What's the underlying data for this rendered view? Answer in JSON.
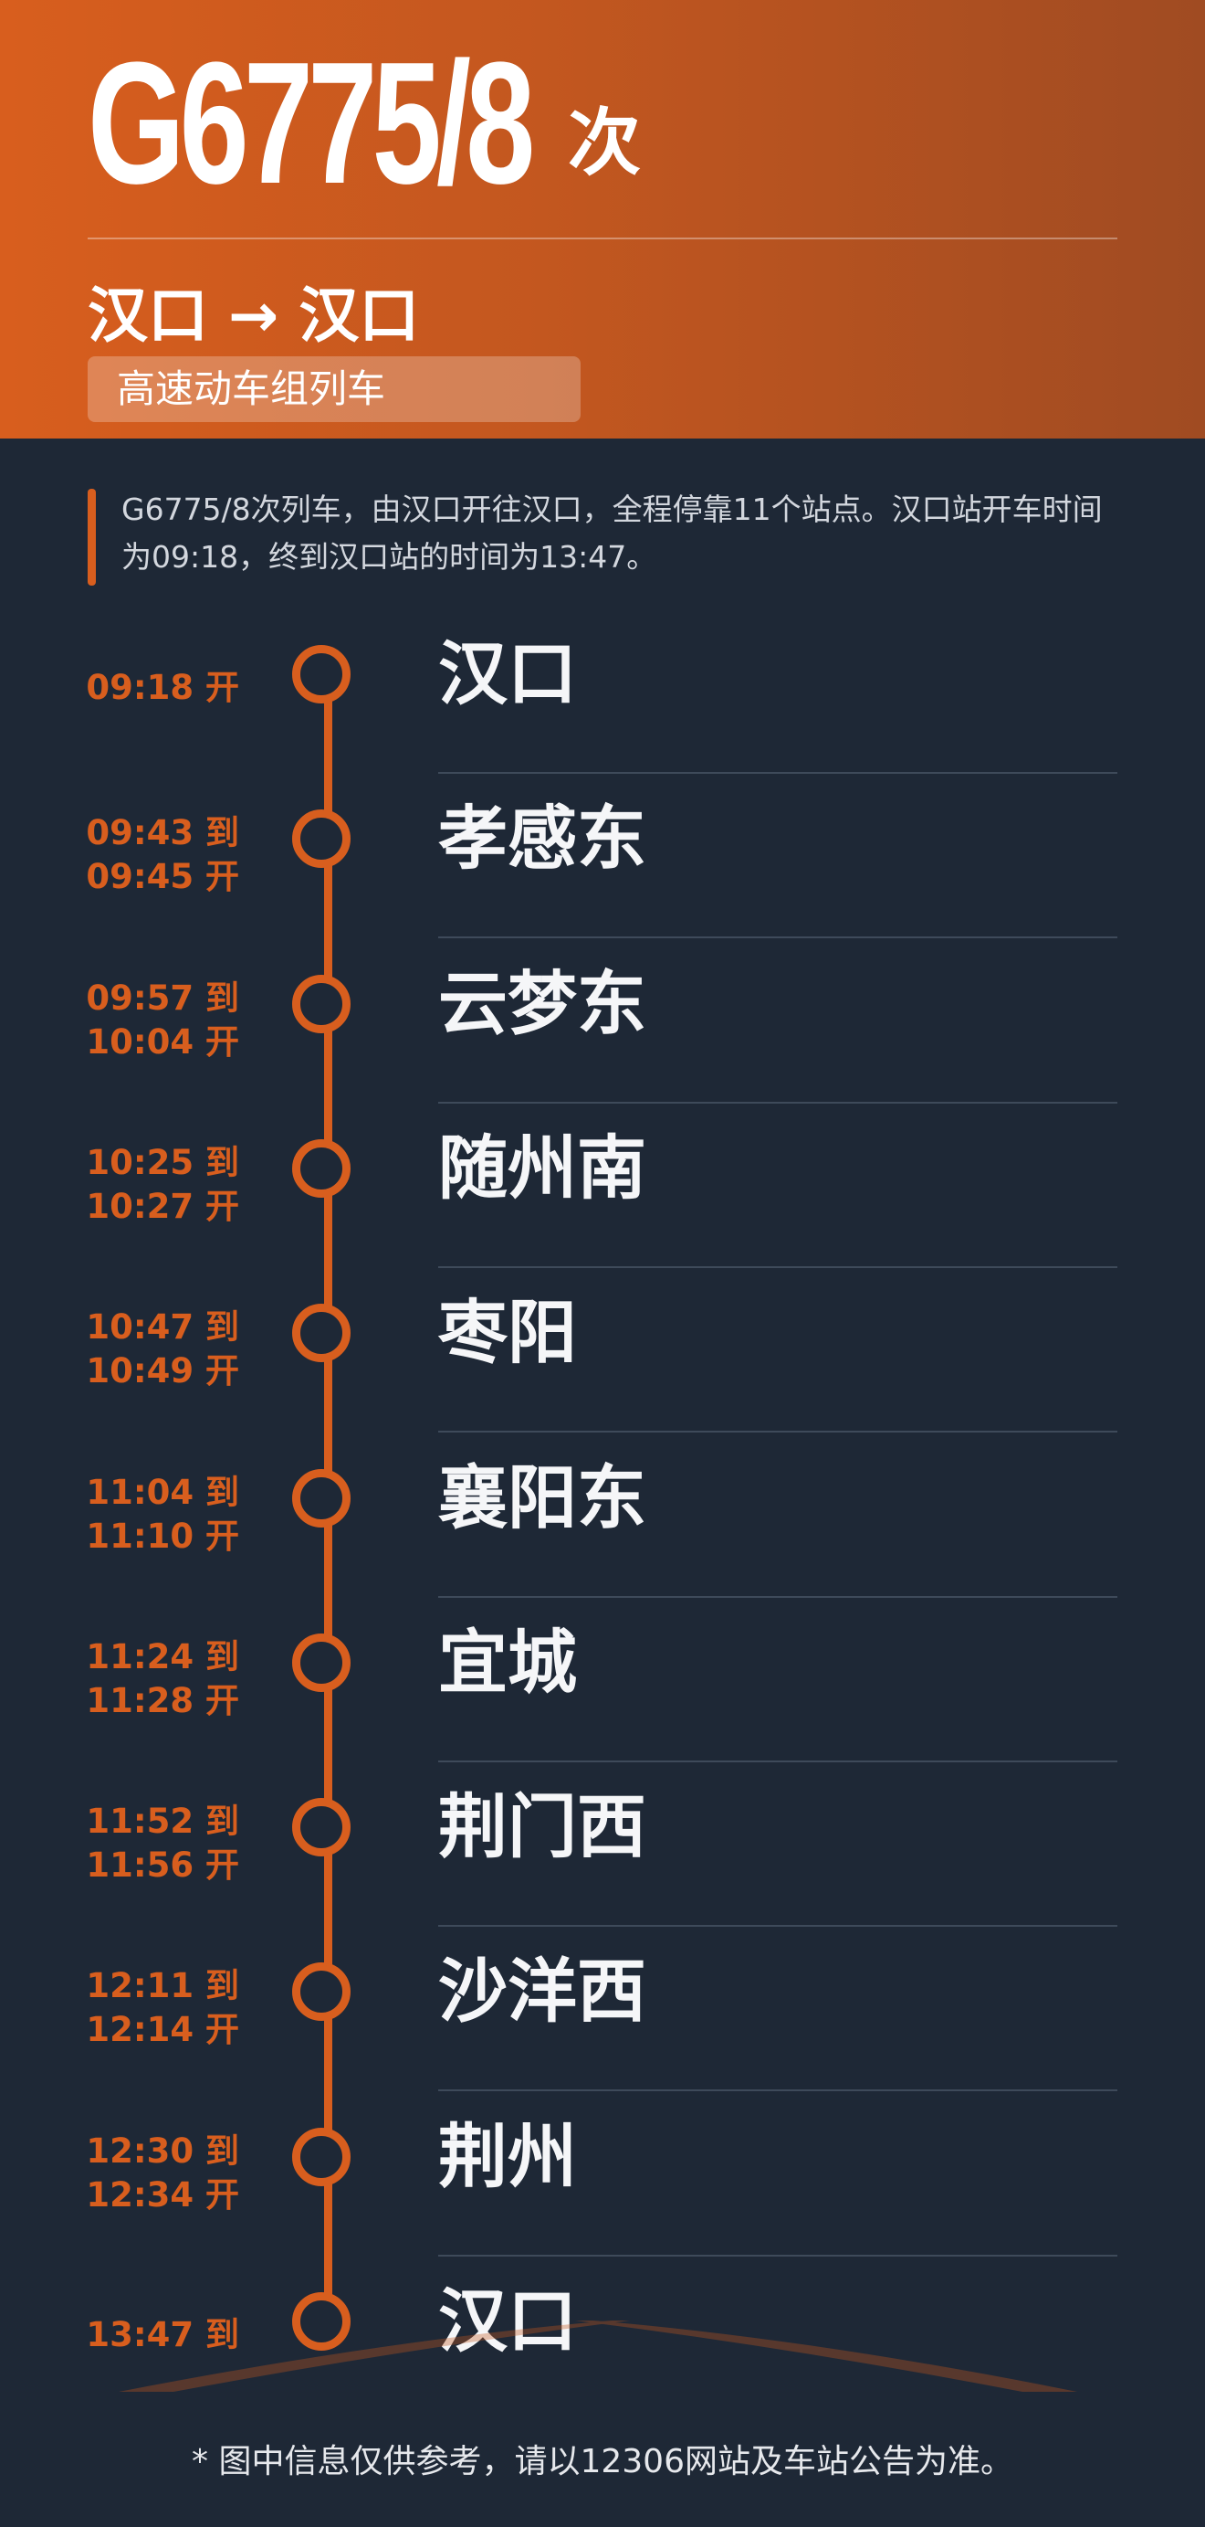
{
  "header": {
    "train_number": "G6775/8",
    "train_suffix": "次",
    "origin": "汉口",
    "arrow": "→",
    "destination": "汉口",
    "train_type": "高速动车组列车"
  },
  "summary": "G6775/8次列车，由汉口开往汉口，全程停靠11个站点。汉口站开车时间为09:18，终到汉口站的时间为13:47。",
  "stops": [
    {
      "arrive": "",
      "depart": "09:18 开",
      "name": "汉口"
    },
    {
      "arrive": "09:43 到",
      "depart": "09:45 开",
      "name": "孝感东"
    },
    {
      "arrive": "09:57 到",
      "depart": "10:04 开",
      "name": "云梦东"
    },
    {
      "arrive": "10:25 到",
      "depart": "10:27 开",
      "name": "随州南"
    },
    {
      "arrive": "10:47 到",
      "depart": "10:49 开",
      "name": "枣阳"
    },
    {
      "arrive": "11:04 到",
      "depart": "11:10 开",
      "name": "襄阳东"
    },
    {
      "arrive": "11:24 到",
      "depart": "11:28 开",
      "name": "宜城"
    },
    {
      "arrive": "11:52 到",
      "depart": "11:56 开",
      "name": "荆门西"
    },
    {
      "arrive": "12:11 到",
      "depart": "12:14 开",
      "name": "沙洋西"
    },
    {
      "arrive": "12:30 到",
      "depart": "12:34 开",
      "name": "荆州"
    },
    {
      "arrive": "13:47 到",
      "depart": "",
      "name": "汉口"
    }
  ],
  "footer": "* 图中信息仅供参考，请以12306网站及车站公告为准。",
  "colors": {
    "accent": "#d85e1e",
    "background": "#1e2836",
    "text": "#f5f6f8"
  }
}
